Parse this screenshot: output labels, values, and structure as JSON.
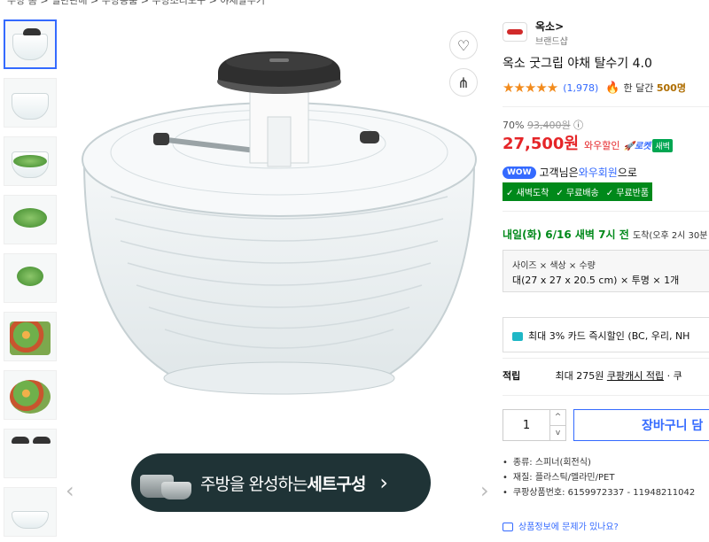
{
  "breadcrumb": "주방 홈 > 일반판매 > 주방용품 > 주방조리도구 > 야채탈수기",
  "thumbnails": [
    {
      "kind": "spinner-top"
    },
    {
      "kind": "spinner-side"
    },
    {
      "kind": "spinner-hand"
    },
    {
      "kind": "greens"
    },
    {
      "kind": "greens-bowl"
    },
    {
      "kind": "salad-plate"
    },
    {
      "kind": "salad-bowl"
    },
    {
      "kind": "spinner-parts"
    },
    {
      "kind": "spinner-parts-2"
    }
  ],
  "banner": {
    "text_plain": "주방을 완성하는",
    "text_bold": "세트구성",
    "chevron": "›"
  },
  "brand": {
    "name": "옥소>",
    "sub": "브랜드샵"
  },
  "product": {
    "title": "옥소 굿그립 야채 탈수기 4.0",
    "stars": "★★★★★",
    "review_count": "(1,978)",
    "sold_prefix": "한 달간",
    "sold_count": "500명"
  },
  "pricing": {
    "discount": "70%",
    "original": "93,400원",
    "info_icon": "ⓘ",
    "price": "27,500원",
    "price_label": "와우할인",
    "rocket": "🚀로켓",
    "saebyeok": "새벽"
  },
  "wow": {
    "badge": "WOW",
    "text_before": "고객님은",
    "text_highlight": "와우회원",
    "text_after": "으로"
  },
  "benefits": [
    "✓ 새벽도착",
    "✓ 무료배송",
    "✓ 무료반품"
  ],
  "delivery": {
    "main": "내일(화) 6/16 새벽 7시 전",
    "sub": "도착(오후 2시 30분"
  },
  "option": {
    "header": "사이즈 × 색상 × 수량",
    "value": "대(27 x 27 x 20.5 cm) × 투명 × 1개"
  },
  "card": {
    "text": "최대 3% 카드 즉시할인 (BC, 우리, NH"
  },
  "cash": {
    "label": "적립",
    "amount": "최대 275원",
    "link": "쿠팡캐시 적립",
    "rest": "· 쿠"
  },
  "quantity": {
    "value": "1",
    "up": "^",
    "down": "v"
  },
  "cart_button": "장바구니 담",
  "specs": [
    "종류: 스피너(회전식)",
    "재질: 플라스틱/멜라민/PET",
    "쿠팡상품번호: 6159972337 - 11948211042"
  ],
  "report_link": "상품정보에 문제가 있나요?",
  "icons": {
    "heart": "♡",
    "share": "⋔",
    "prev": "‹",
    "next": "›",
    "hot": "🔥"
  },
  "colors": {
    "accent": "#346aff",
    "price": "#e52528",
    "star": "#f28b1d",
    "rocket_green": "#00891a"
  }
}
